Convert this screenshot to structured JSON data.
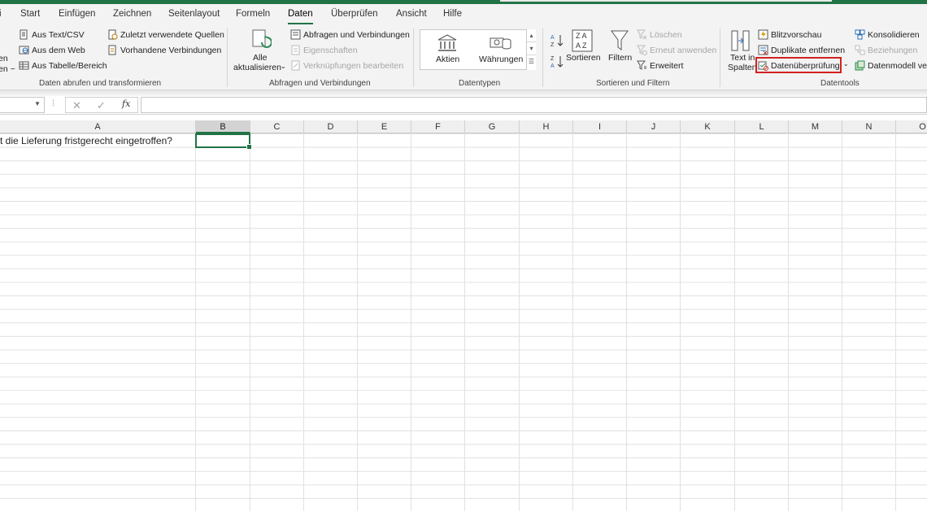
{
  "ribbon_tabs": [
    "i",
    "Start",
    "Einfügen",
    "Zeichnen",
    "Seitenlayout",
    "Formeln",
    "Daten",
    "Überprüfen",
    "Ansicht",
    "Hilfe"
  ],
  "active_tab": "Daten",
  "groups": {
    "abrufen": {
      "label": "Daten abrufen und transformieren",
      "cut_lines": [
        "en",
        "en ~"
      ],
      "aus_text_csv": "Aus Text/CSV",
      "aus_dem_web": "Aus dem Web",
      "aus_tabelle": "Aus Tabelle/Bereich",
      "zuletzt_quellen": "Zuletzt verwendete Quellen",
      "vorhandene_verbindungen": "Vorhandene Verbindungen"
    },
    "abfragen": {
      "label": "Abfragen und Verbindungen",
      "alle": "Alle",
      "aktualisieren": "aktualisieren",
      "abfragen_verbindungen": "Abfragen und Verbindungen",
      "eigenschaften": "Eigenschaften",
      "verknuepfungen": "Verknüpfungen bearbeiten"
    },
    "datentypen": {
      "label": "Datentypen",
      "aktien": "Aktien",
      "waehrungen": "Währungen"
    },
    "sortieren": {
      "label": "Sortieren und Filtern",
      "sortieren": "Sortieren",
      "filtern": "Filtern",
      "loeschen": "Löschen",
      "erneut_anwenden": "Erneut anwenden",
      "erweitert": "Erweitert"
    },
    "datentools": {
      "label": "Datentools",
      "text_in": "Text in",
      "spalten": "Spalten",
      "blitzvorschau": "Blitzvorschau",
      "duplikate": "Duplikate entfernen",
      "datenueberpruefung": "Datenüberprüfung",
      "konsolidieren": "Konsolidieren",
      "beziehungen": "Beziehungen",
      "datenmodell": "Datenmodell verw"
    }
  },
  "formula_bar": {
    "cancel": "✕",
    "confirm": "✓",
    "fx": "fx",
    "value": ""
  },
  "columns": [
    "A",
    "B",
    "C",
    "D",
    "E",
    "F",
    "G",
    "H",
    "I",
    "J",
    "K",
    "L",
    "M",
    "N",
    "O"
  ],
  "selected_column": "B",
  "cell_a1": "t die Lieferung fristgerecht eingetroffen?",
  "colors": {
    "excel_green": "#217346",
    "highlight_red": "#d32020"
  }
}
